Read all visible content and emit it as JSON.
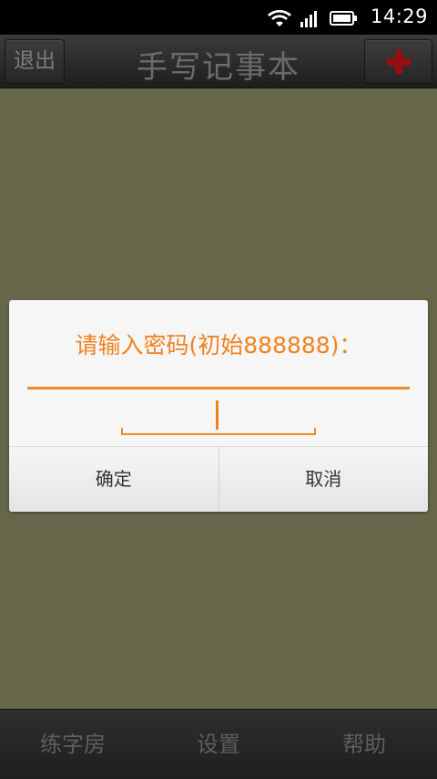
{
  "status_bar": {
    "time": "14:29",
    "icons": [
      "wifi-icon",
      "signal-icon",
      "battery-icon"
    ]
  },
  "header": {
    "exit_label": "退出",
    "title": "手写记事本",
    "add_icon": "plus-icon",
    "add_color": "#9a0e0e"
  },
  "dialog": {
    "prompt": "请输入密码(初始888888)：",
    "password_value": "",
    "confirm_label": "确定",
    "cancel_label": "取消",
    "accent_color": "#f0821e"
  },
  "bottom_nav": {
    "items": [
      {
        "label": "练字房"
      },
      {
        "label": "设置"
      },
      {
        "label": "帮助"
      }
    ]
  },
  "colors": {
    "background": "#66664a"
  }
}
